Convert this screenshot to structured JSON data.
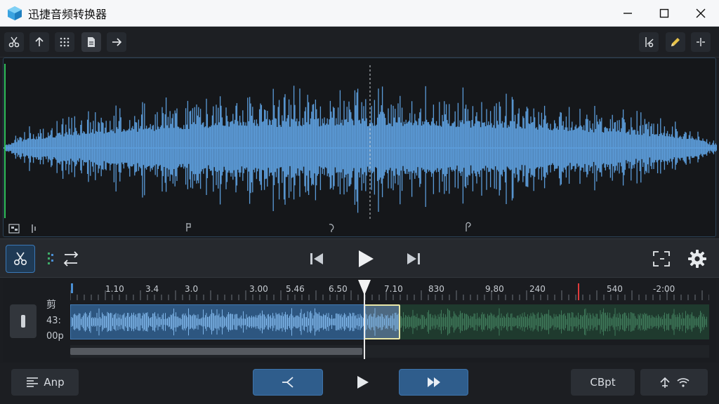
{
  "window": {
    "title": "迅捷音频转换器"
  },
  "colors": {
    "accent": "#4a8fd4",
    "waveform": "#5b9bd8",
    "clip_selected": "#5a92c8",
    "clip_unselected": "#2e5a42",
    "marker": "#e03b3b"
  },
  "toolbar": {
    "left_icons": [
      "scissors-icon",
      "arrow-up-icon",
      "grid-dots-icon",
      "document-icon",
      "arrow-right-icon"
    ],
    "right_icons": [
      "fade-icon",
      "pencil-icon",
      "split-icon"
    ]
  },
  "timeline": {
    "ticks": [
      "1.10",
      "3.4",
      "3.0",
      "3.00",
      "5.46",
      "6.50",
      "7.10",
      "830",
      "9.80",
      "240",
      "540",
      "-2:00"
    ],
    "track_labels": [
      "剪",
      "43:",
      "00p"
    ]
  },
  "bottombar": {
    "left_label": "Anp",
    "right_label": "CBpt"
  }
}
